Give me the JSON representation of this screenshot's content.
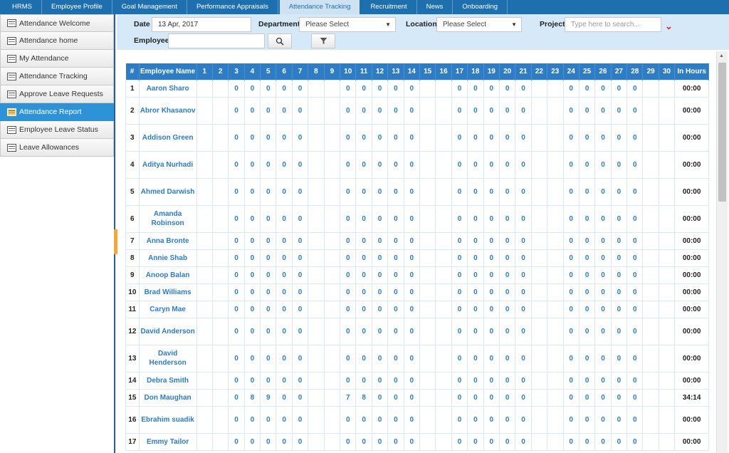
{
  "tabs": [
    "HRMS",
    "Employee Profile",
    "Goal Management",
    "Performance Appraisals",
    "Attendance Tracking",
    "Recruitment",
    "News",
    "Onboarding"
  ],
  "active_tab": "Attendance Tracking",
  "sidebar": {
    "items": [
      {
        "label": "Attendance Welcome",
        "icon": "calendar-icon"
      },
      {
        "label": "Attendance home",
        "icon": "calendar-icon"
      },
      {
        "label": "My Attendance",
        "icon": "people-icon"
      },
      {
        "label": "Attendance Tracking",
        "icon": "tracking-icon"
      },
      {
        "label": "Approve Leave Requests",
        "icon": "approve-icon"
      },
      {
        "label": "Attendance Report",
        "icon": "report-icon"
      },
      {
        "label": "Employee Leave Status",
        "icon": "calendar-icon"
      },
      {
        "label": "Leave Allowances",
        "icon": "checklist-icon"
      }
    ],
    "active": "Attendance Report"
  },
  "filters": {
    "date_label": "Date",
    "date_value": "13 Apr, 2017",
    "department_label": "Department",
    "department_value": "Please Select",
    "location_label": "Location",
    "location_value": "Please Select",
    "project_label": "Project",
    "project_placeholder": "Type here to search...",
    "employee_label": "Employee",
    "employee_value": ""
  },
  "table": {
    "headers": [
      "#",
      "Employee Name",
      "1",
      "2",
      "3",
      "4",
      "5",
      "6",
      "7",
      "8",
      "9",
      "10",
      "11",
      "12",
      "13",
      "14",
      "15",
      "16",
      "17",
      "18",
      "19",
      "20",
      "21",
      "22",
      "23",
      "24",
      "25",
      "26",
      "27",
      "28",
      "29",
      "30",
      "In Hours"
    ],
    "rows": [
      {
        "num": "1",
        "name": "Aaron Sharo",
        "days": {
          "3": "0",
          "4": "0",
          "5": "0",
          "6": "0",
          "7": "0",
          "10": "0",
          "11": "0",
          "12": "0",
          "13": "0",
          "14": "0",
          "17": "0",
          "18": "0",
          "19": "0",
          "20": "0",
          "21": "0",
          "24": "0",
          "25": "0",
          "26": "0",
          "27": "0",
          "28": "0"
        },
        "hours": "00:00",
        "tall": false
      },
      {
        "num": "2",
        "name": "Abror Khasanov",
        "days": {
          "3": "0",
          "4": "0",
          "5": "0",
          "6": "0",
          "7": "0",
          "10": "0",
          "11": "0",
          "12": "0",
          "13": "0",
          "14": "0",
          "17": "0",
          "18": "0",
          "19": "0",
          "20": "0",
          "21": "0",
          "24": "0",
          "25": "0",
          "26": "0",
          "27": "0",
          "28": "0"
        },
        "hours": "00:00",
        "tall": true
      },
      {
        "num": "3",
        "name": "Addison Green",
        "days": {
          "3": "0",
          "4": "0",
          "5": "0",
          "6": "0",
          "7": "0",
          "10": "0",
          "11": "0",
          "12": "0",
          "13": "0",
          "14": "0",
          "17": "0",
          "18": "0",
          "19": "0",
          "20": "0",
          "21": "0",
          "24": "0",
          "25": "0",
          "26": "0",
          "27": "0",
          "28": "0"
        },
        "hours": "00:00",
        "tall": true
      },
      {
        "num": "4",
        "name": "Aditya Nurhadi",
        "days": {
          "3": "0",
          "4": "0",
          "5": "0",
          "6": "0",
          "7": "0",
          "10": "0",
          "11": "0",
          "12": "0",
          "13": "0",
          "14": "0",
          "17": "0",
          "18": "0",
          "19": "0",
          "20": "0",
          "21": "0",
          "24": "0",
          "25": "0",
          "26": "0",
          "27": "0",
          "28": "0"
        },
        "hours": "00:00",
        "tall": true
      },
      {
        "num": "5",
        "name": "Ahmed Darwish",
        "days": {
          "3": "0",
          "4": "0",
          "5": "0",
          "6": "0",
          "7": "0",
          "10": "0",
          "11": "0",
          "12": "0",
          "13": "0",
          "14": "0",
          "17": "0",
          "18": "0",
          "19": "0",
          "20": "0",
          "21": "0",
          "24": "0",
          "25": "0",
          "26": "0",
          "27": "0",
          "28": "0"
        },
        "hours": "00:00",
        "tall": true
      },
      {
        "num": "6",
        "name": "Amanda Robinson",
        "days": {
          "3": "0",
          "4": "0",
          "5": "0",
          "6": "0",
          "7": "0",
          "10": "0",
          "11": "0",
          "12": "0",
          "13": "0",
          "14": "0",
          "17": "0",
          "18": "0",
          "19": "0",
          "20": "0",
          "21": "0",
          "24": "0",
          "25": "0",
          "26": "0",
          "27": "0",
          "28": "0"
        },
        "hours": "00:00",
        "tall": true
      },
      {
        "num": "7",
        "name": "Anna Bronte",
        "days": {
          "3": "0",
          "4": "0",
          "5": "0",
          "6": "0",
          "7": "0",
          "10": "0",
          "11": "0",
          "12": "0",
          "13": "0",
          "14": "0",
          "17": "0",
          "18": "0",
          "19": "0",
          "20": "0",
          "21": "0",
          "24": "0",
          "25": "0",
          "26": "0",
          "27": "0",
          "28": "0"
        },
        "hours": "00:00",
        "tall": false
      },
      {
        "num": "8",
        "name": "Annie Shab",
        "days": {
          "3": "0",
          "4": "0",
          "5": "0",
          "6": "0",
          "7": "0",
          "10": "0",
          "11": "0",
          "12": "0",
          "13": "0",
          "14": "0",
          "17": "0",
          "18": "0",
          "19": "0",
          "20": "0",
          "21": "0",
          "24": "0",
          "25": "0",
          "26": "0",
          "27": "0",
          "28": "0"
        },
        "hours": "00:00",
        "tall": false
      },
      {
        "num": "9",
        "name": "Anoop Balan",
        "days": {
          "3": "0",
          "4": "0",
          "5": "0",
          "6": "0",
          "7": "0",
          "10": "0",
          "11": "0",
          "12": "0",
          "13": "0",
          "14": "0",
          "17": "0",
          "18": "0",
          "19": "0",
          "20": "0",
          "21": "0",
          "24": "0",
          "25": "0",
          "26": "0",
          "27": "0",
          "28": "0"
        },
        "hours": "00:00",
        "tall": false
      },
      {
        "num": "10",
        "name": "Brad Williams",
        "days": {
          "3": "0",
          "4": "0",
          "5": "0",
          "6": "0",
          "7": "0",
          "10": "0",
          "11": "0",
          "12": "0",
          "13": "0",
          "14": "0",
          "17": "0",
          "18": "0",
          "19": "0",
          "20": "0",
          "21": "0",
          "24": "0",
          "25": "0",
          "26": "0",
          "27": "0",
          "28": "0"
        },
        "hours": "00:00",
        "tall": false
      },
      {
        "num": "11",
        "name": "Caryn Mae",
        "days": {
          "3": "0",
          "4": "0",
          "5": "0",
          "6": "0",
          "7": "0",
          "10": "0",
          "11": "0",
          "12": "0",
          "13": "0",
          "14": "0",
          "17": "0",
          "18": "0",
          "19": "0",
          "20": "0",
          "21": "0",
          "24": "0",
          "25": "0",
          "26": "0",
          "27": "0",
          "28": "0"
        },
        "hours": "00:00",
        "tall": false
      },
      {
        "num": "12",
        "name": "David Anderson",
        "days": {
          "3": "0",
          "4": "0",
          "5": "0",
          "6": "0",
          "7": "0",
          "10": "0",
          "11": "0",
          "12": "0",
          "13": "0",
          "14": "0",
          "17": "0",
          "18": "0",
          "19": "0",
          "20": "0",
          "21": "0",
          "24": "0",
          "25": "0",
          "26": "0",
          "27": "0",
          "28": "0"
        },
        "hours": "00:00",
        "tall": true
      },
      {
        "num": "13",
        "name": "David Henderson",
        "days": {
          "3": "0",
          "4": "0",
          "5": "0",
          "6": "0",
          "7": "0",
          "10": "0",
          "11": "0",
          "12": "0",
          "13": "0",
          "14": "0",
          "17": "0",
          "18": "0",
          "19": "0",
          "20": "0",
          "21": "0",
          "24": "0",
          "25": "0",
          "26": "0",
          "27": "0",
          "28": "0"
        },
        "hours": "00:00",
        "tall": true
      },
      {
        "num": "14",
        "name": "Debra Smith",
        "days": {
          "3": "0",
          "4": "0",
          "5": "0",
          "6": "0",
          "7": "0",
          "10": "0",
          "11": "0",
          "12": "0",
          "13": "0",
          "14": "0",
          "17": "0",
          "18": "0",
          "19": "0",
          "20": "0",
          "21": "0",
          "24": "0",
          "25": "0",
          "26": "0",
          "27": "0",
          "28": "0"
        },
        "hours": "00:00",
        "tall": false
      },
      {
        "num": "15",
        "name": "Don Maughan",
        "days": {
          "3": "0",
          "4": "8",
          "5": "9",
          "6": "0",
          "7": "0",
          "10": "7",
          "11": "8",
          "12": "0",
          "13": "0",
          "14": "0",
          "17": "0",
          "18": "0",
          "19": "0",
          "20": "0",
          "21": "0",
          "24": "0",
          "25": "0",
          "26": "0",
          "27": "0",
          "28": "0"
        },
        "hours": "34:14",
        "tall": false
      },
      {
        "num": "16",
        "name": "Ebrahim suadik",
        "days": {
          "3": "0",
          "4": "0",
          "5": "0",
          "6": "0",
          "7": "0",
          "10": "0",
          "11": "0",
          "12": "0",
          "13": "0",
          "14": "0",
          "17": "0",
          "18": "0",
          "19": "0",
          "20": "0",
          "21": "0",
          "24": "0",
          "25": "0",
          "26": "0",
          "27": "0",
          "28": "0"
        },
        "hours": "00:00",
        "tall": true
      },
      {
        "num": "17",
        "name": "Emmy Tailor",
        "days": {
          "3": "0",
          "4": "0",
          "5": "0",
          "6": "0",
          "7": "0",
          "10": "0",
          "11": "0",
          "12": "0",
          "13": "0",
          "14": "0",
          "17": "0",
          "18": "0",
          "19": "0",
          "20": "0",
          "21": "0",
          "24": "0",
          "25": "0",
          "26": "0",
          "27": "0",
          "28": "0"
        },
        "hours": "00:00",
        "tall": false
      }
    ]
  },
  "colors": {
    "accent": "#2e7cc4",
    "tab_bar": "#1e6fae",
    "filter_bg": "#d5e9f8",
    "sidebar_active": "#2e93d6"
  }
}
